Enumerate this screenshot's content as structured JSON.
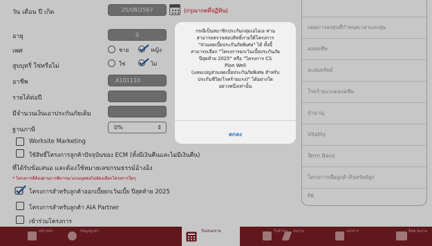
{
  "form": {
    "birthdate": {
      "label": "วัน เดือน ปี เกิด",
      "value": "25/08/2567",
      "hint": "(กรุณากดที่ปฏิทิน)"
    },
    "age": {
      "label": "อายุ",
      "value": "0"
    },
    "gender": {
      "label": "เพศ",
      "options": [
        "ชาย",
        "หญิง"
      ],
      "selected": "หญิง"
    },
    "smoker": {
      "label": "สูบบุหรี่ ใช่หรือไม่",
      "options": [
        "ใช่",
        "ไม่"
      ],
      "selected": "ไม่"
    },
    "occupation": {
      "label": "อาชีพ",
      "value": "A101110"
    },
    "income": {
      "label": "รายได้ต่อปี"
    },
    "sum_insured": {
      "label": "มีจำนวนเงินเอาประกันภัยเดิม"
    },
    "base_tax": {
      "label": "ฐานภาษี",
      "value": "0%"
    },
    "worksite": "Worksite Marketing",
    "ecm": "ใช้สิทธิ์โครงการลูกค้าปัจจุบันของ ECM (ทั้งมีเงินคืนและไม่มีเงินคืน)",
    "ecm_sub": "ที่ได้รับข้อเสนอ และต้องใช้หมายเลขกรมธรรม์อ้างอิง",
    "red_note": "* โครงการที่ต้องผ่านการพิจารณาแบบบุคคลไม่ต้องเลือกโครงการใดๆ",
    "promo_2025": "โครงการสำหรับลูกค้าออกเบี้ยยกเว้นเบี้ย ปีสุดท้าย 2025",
    "aia_partner": "โครงการสำหรับลูกค้า AIA Partner",
    "join": "เข้าร่วมโครงการ"
  },
  "right_menu": [
    "แผนการลงทุนที่กำหนดเวลาและทุน",
    "ตลอดชีพ",
    "สะสมทรัพย์",
    "โรคร้ายแรงตลอดชีพ",
    "บำนาญ",
    "Vitality",
    "Term Basic",
    "โครงการเพื่อลูกค้าสินทรัพย์สูง",
    "PA"
  ],
  "dialog": {
    "message": "กรณีเป็นสมาชิกประกันกลุ่มเอไอเอ ท่าน\nสามารถตรวจสอบสิทธิ์ภายใต้โครงการ\n\"ส่วนลดเบี้ยประกันภัยพิเศษ\" ได้ ทั้งนี้\nสามารถเลือก \"โครงการยกเว้นเบี้ยประกันภัย\nปีสุดท้าย 2025\" หรือ \"โครงการ CS\nPlan Well\n(แคมเปญส่วนลดเบี้ยประกันภัยพิเศษ สำหรับ\nประกันชีวิต/โรคร้ายแรง)\" ได้อย่างใด\nอย่างหนึ่งเท่านั้น",
    "ok": "ตกลง"
  },
  "tabbar": {
    "items": [
      "หน้าหลัก",
      "ข้อมูลลูกค้า",
      "ใบเสนอขาย",
      "ใบคำขอ",
      "ส่งงาน",
      "เอกสาร",
      "ติดตามงาน"
    ],
    "active": "ใบเสนอขาย"
  },
  "colors": {
    "brand": "#7c1f24",
    "hint_red": "#d0021b",
    "link_blue": "#2a6fd6"
  }
}
